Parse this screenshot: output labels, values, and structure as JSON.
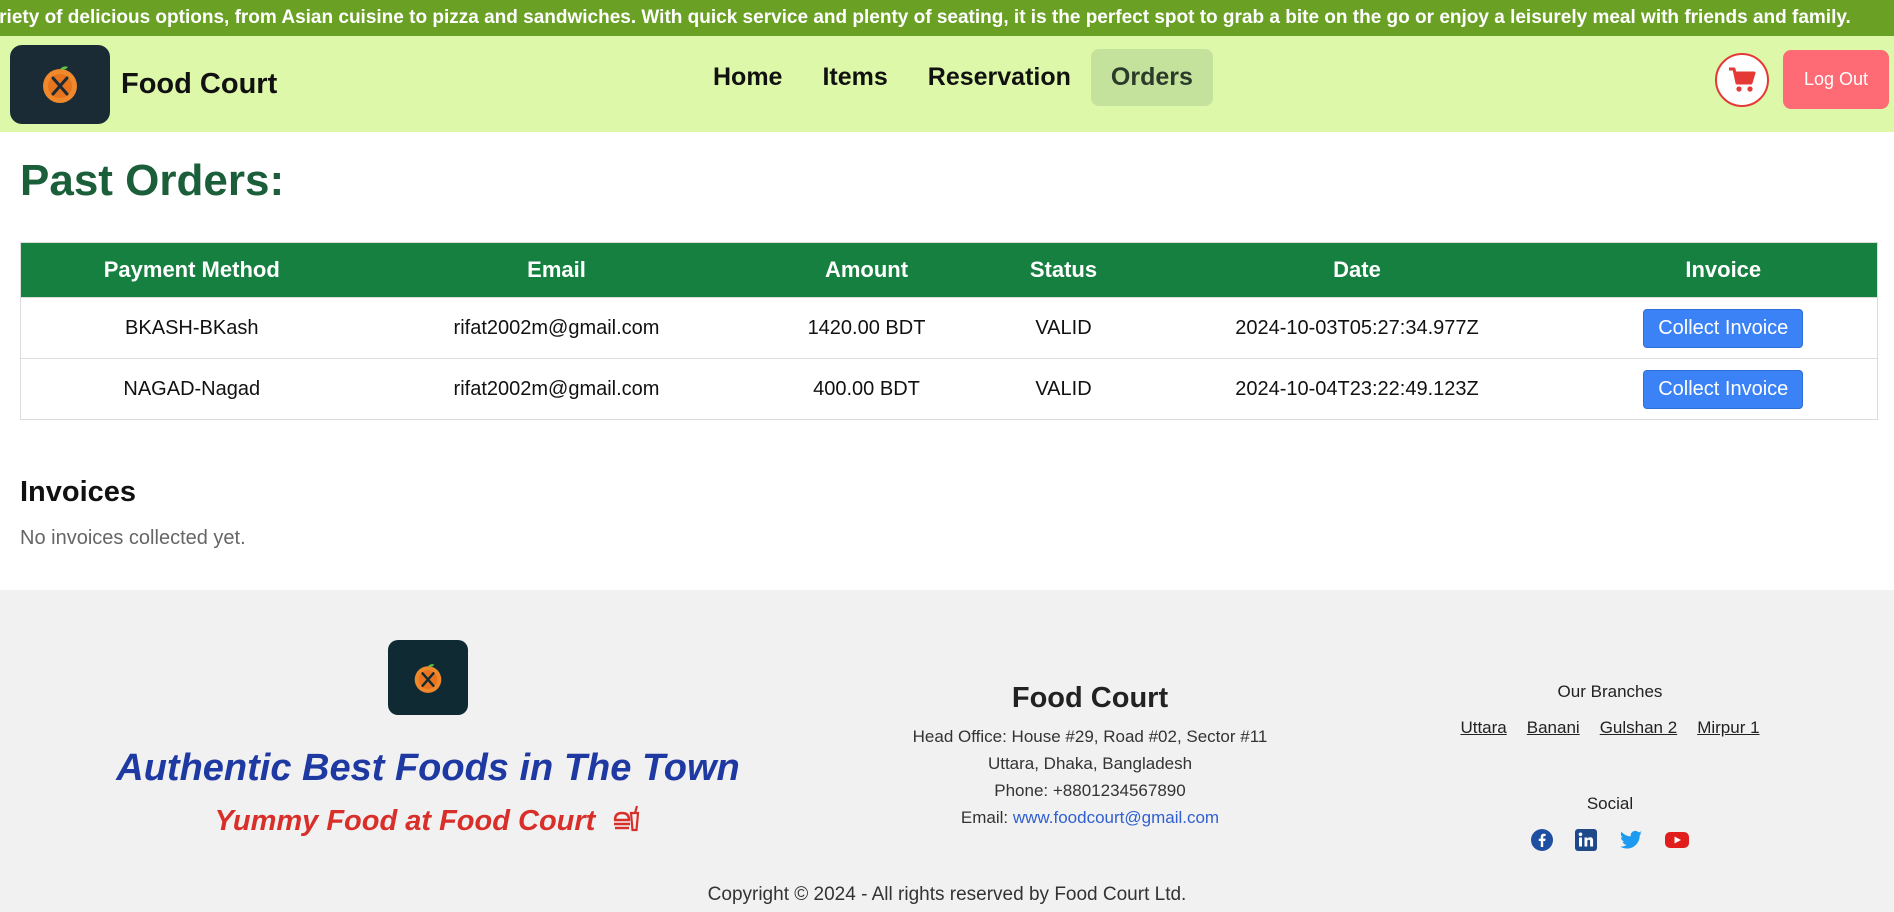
{
  "ticker": {
    "text": "ts a variety of delicious options, from Asian cuisine to pizza and sandwiches. With quick service and plenty of seating, it is the perfect spot to grab a bite on the go or enjoy a leisurely meal with friends and family."
  },
  "navbar": {
    "brand": "Food Court",
    "links": [
      {
        "label": "Home"
      },
      {
        "label": "Items"
      },
      {
        "label": "Reservation"
      },
      {
        "label": "Orders",
        "active": true
      }
    ],
    "logout_label": "Log Out",
    "cart_icon": "cart-icon"
  },
  "orders": {
    "title": "Past Orders:",
    "columns": [
      "Payment Method",
      "Email",
      "Amount",
      "Status",
      "Date",
      "Invoice"
    ],
    "rows": [
      {
        "method": "BKASH-BKash",
        "email": "rifat2002m@gmail.com",
        "amount": "1420.00 BDT",
        "status": "VALID",
        "date": "2024-10-03T05:27:34.977Z",
        "invoice_label": "Collect Invoice"
      },
      {
        "method": "NAGAD-Nagad",
        "email": "rifat2002m@gmail.com",
        "amount": "400.00 BDT",
        "status": "VALID",
        "date": "2024-10-04T23:22:49.123Z",
        "invoice_label": "Collect Invoice"
      }
    ]
  },
  "invoices": {
    "title": "Invoices",
    "empty_text": "No invoices collected yet."
  },
  "footer": {
    "tagline": "Authentic Best Foods in The Town",
    "subtagline": "Yummy Food at Food Court",
    "name": "Food Court",
    "address1": "Head Office: House #29, Road #02, Sector #11",
    "address2": "Uttara, Dhaka, Bangladesh",
    "phone": "Phone: +8801234567890",
    "email_label": "Email:",
    "email_link": "www.foodcourt@gmail.com",
    "branches_title": "Our Branches",
    "branches": [
      "Uttara",
      "Banani",
      "Gulshan 2",
      "Mirpur 1"
    ],
    "social_title": "Social",
    "social_icons": [
      "facebook-icon",
      "linkedin-icon",
      "twitter-icon",
      "youtube-icon"
    ],
    "copyright": "Copyright © 2024 - All rights reserved by Food Court Ltd."
  },
  "colors": {
    "ticker_bg": "#6aa024",
    "navbar_bg": "#dcf8a8",
    "table_header": "#168040",
    "button_blue": "#3b82f6",
    "logout": "#fe6b74",
    "title_green": "#1b5e3a"
  }
}
